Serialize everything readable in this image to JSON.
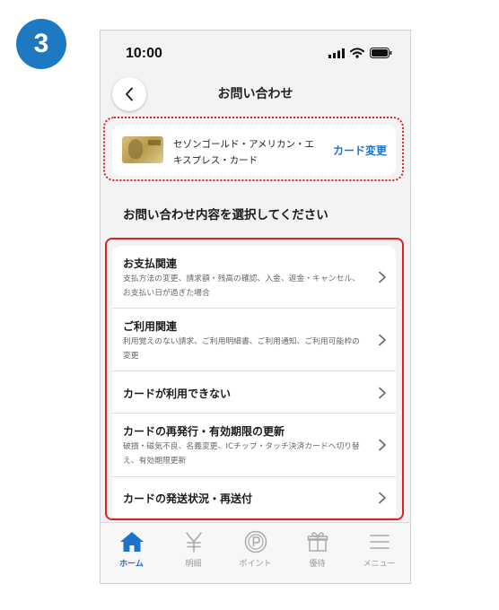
{
  "step_number": "3",
  "status_bar": {
    "time": "10:00"
  },
  "nav": {
    "title": "お問い合わせ"
  },
  "card": {
    "name": "セゾンゴールド・アメリカン・エキスプレス・カード",
    "change_label": "カード変更"
  },
  "section_title": "お問い合わせ内容を選択してください",
  "inquiry_items": [
    {
      "title": "お支払関連",
      "description": "支払方法の変更、請求額・残高の確認、入金、返金・キャンセル、お支払い日が過ぎた場合"
    },
    {
      "title": "ご利用関連",
      "description": "利用覚えのない請求、ご利用明細書、ご利用通知、ご利用可能枠の変更"
    },
    {
      "title": "カードが利用できない",
      "description": ""
    },
    {
      "title": "カードの再発行・有効期限の更新",
      "description": "破損・磁気不良、名義変更、ICチップ・タッチ決済カードへ切り替え、有効期限更新"
    },
    {
      "title": "カードの発送状況・再送付",
      "description": ""
    }
  ],
  "tab_bar": {
    "tabs": [
      {
        "label": "ホーム",
        "icon": "home-icon",
        "active": true
      },
      {
        "label": "明細",
        "icon": "yen-icon",
        "active": false
      },
      {
        "label": "ポイント",
        "icon": "point-icon",
        "active": false
      },
      {
        "label": "優待",
        "icon": "gift-icon",
        "active": false
      },
      {
        "label": "メニュー",
        "icon": "menu-icon",
        "active": false
      }
    ]
  },
  "colors": {
    "accent": "#1c73c9",
    "badge": "#1c79c2",
    "highlight": "#e02020"
  }
}
